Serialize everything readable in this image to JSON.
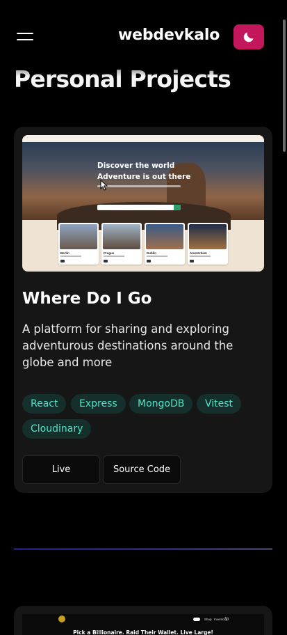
{
  "header": {
    "logo": "webdevkalo",
    "menu_icon": "hamburger-icon",
    "theme_icon": "moon-icon",
    "theme_color": "#c2185b"
  },
  "page": {
    "title": "Personal Projects"
  },
  "project": {
    "title": "Where Do I Go",
    "description": "A platform for sharing and exploring adventurous destinations around the globe and more",
    "screenshot": {
      "headline_1": "Discover the world",
      "headline_2": "Adventure is out there",
      "cities": [
        "Berlin",
        "Prague",
        "Dublin",
        "Amsterdam"
      ]
    },
    "tags": [
      "React",
      "Express",
      "MongoDB",
      "Vitest",
      "Cloudinary"
    ],
    "buttons": {
      "live": "Live",
      "source": "Source Code"
    },
    "tag_color": "#4fe3c4"
  },
  "next_project": {
    "screenshot_headline": "Pick a Billionaire. Raid Their Wallet. Live Large!",
    "nav": [
      "Shop",
      "Inventory"
    ]
  },
  "divider_color": "#8f86e8"
}
